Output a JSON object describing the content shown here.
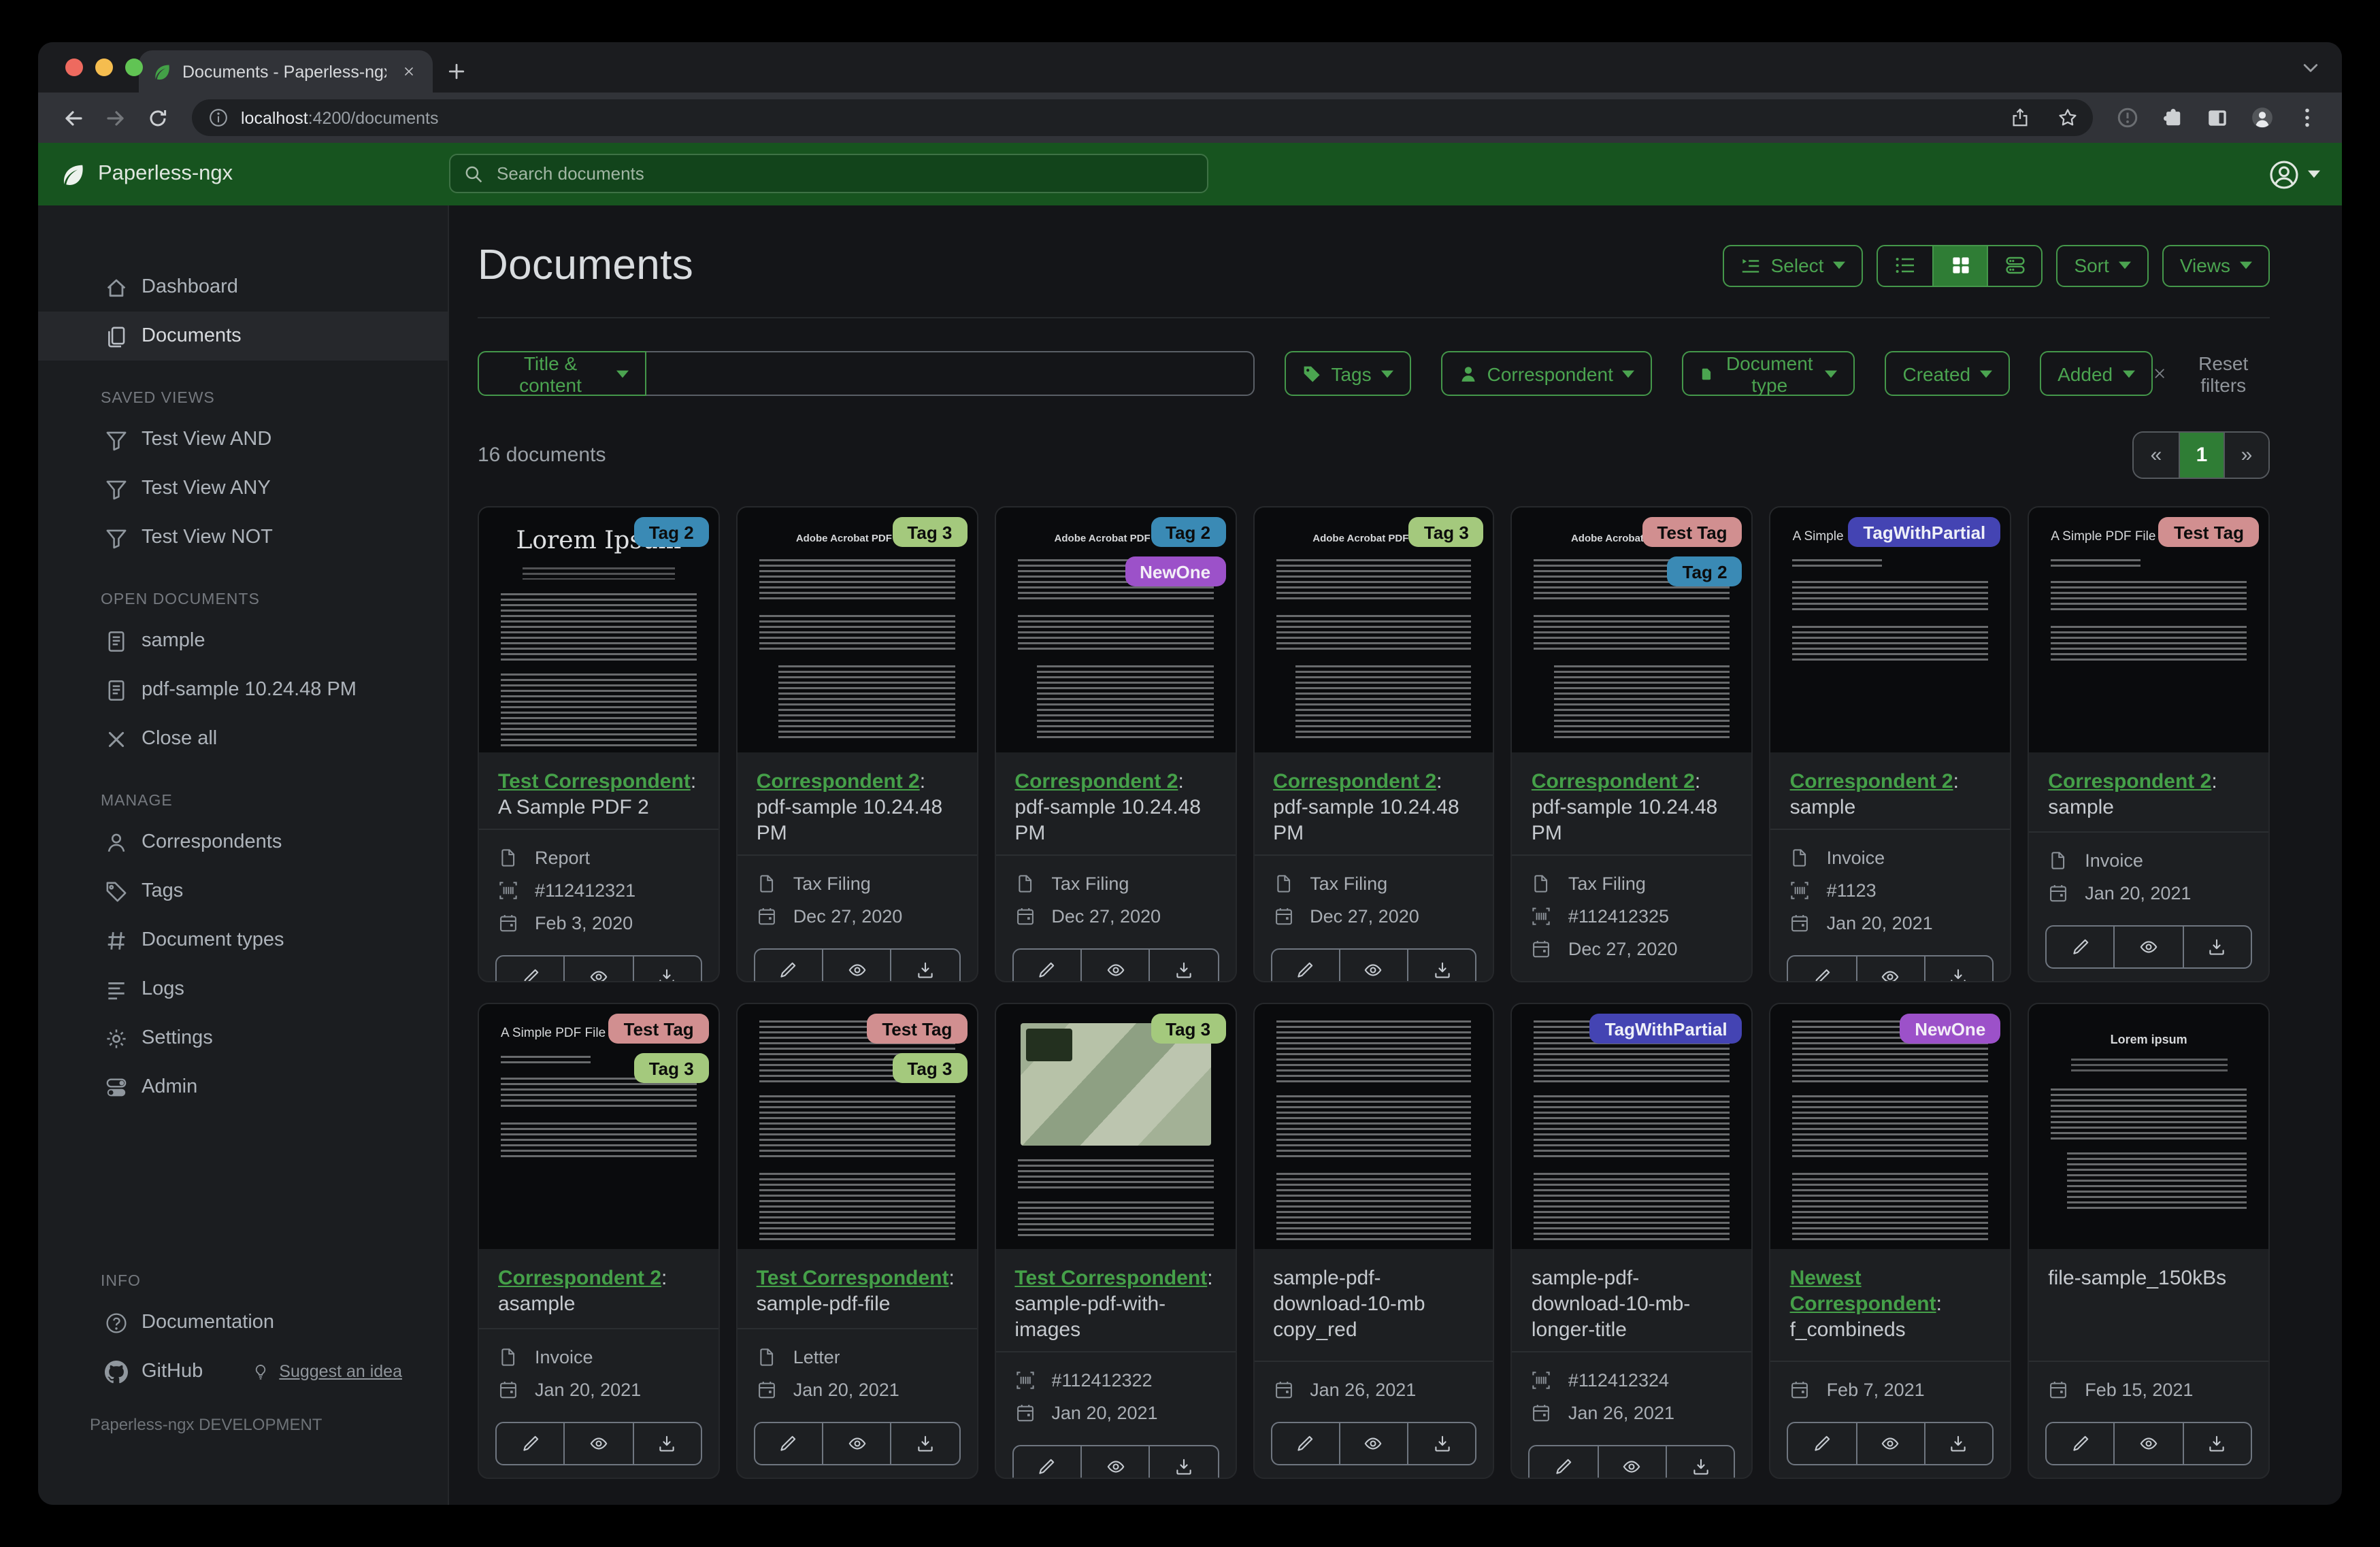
{
  "theme": {
    "navbar_green": "#17541f",
    "accent_green": "#44974a",
    "accent_text": "#4ba450",
    "active_green": "#2f7d35",
    "link_green": "#45a049"
  },
  "browser": {
    "traffic_lights": [
      "#ee6a5f",
      "#f5bd4f",
      "#61c454"
    ],
    "tab": {
      "title": "Documents - Paperless-ngx",
      "favicon": "leaf-icon"
    },
    "url": {
      "host": "localhost",
      "rest": ":4200/documents"
    }
  },
  "navbar": {
    "brand": "Paperless-ngx",
    "search_placeholder": "Search documents"
  },
  "icons": {
    "brand": "leaf-icon",
    "search": "magnifier-icon",
    "user_menu": "person-circle-icon",
    "document_type": "file-icon",
    "asn": "barcode-icon",
    "created": "calendar-icon",
    "edit": "pencil-icon",
    "preview": "eye-icon",
    "download": "download-icon"
  },
  "sidebar": {
    "items_primary": [
      {
        "label": "Dashboard",
        "icon": "home",
        "active": false
      },
      {
        "label": "Documents",
        "icon": "documents",
        "active": true
      }
    ],
    "sections": [
      {
        "title": "SAVED VIEWS",
        "items": [
          {
            "label": "Test View AND",
            "icon": "funnel"
          },
          {
            "label": "Test View ANY",
            "icon": "funnel"
          },
          {
            "label": "Test View NOT",
            "icon": "funnel"
          }
        ]
      },
      {
        "title": "OPEN DOCUMENTS",
        "items": [
          {
            "label": "sample",
            "icon": "file-text"
          },
          {
            "label": "pdf-sample 10.24.48 PM",
            "icon": "file-text"
          },
          {
            "label": "Close all",
            "icon": "close"
          }
        ]
      },
      {
        "title": "MANAGE",
        "items": [
          {
            "label": "Correspondents",
            "icon": "person"
          },
          {
            "label": "Tags",
            "icon": "tag"
          },
          {
            "label": "Document types",
            "icon": "hash"
          },
          {
            "label": "Logs",
            "icon": "lines"
          },
          {
            "label": "Settings",
            "icon": "gear"
          },
          {
            "label": "Admin",
            "icon": "toggles"
          }
        ]
      },
      {
        "title": "INFO",
        "items": [
          {
            "label": "Documentation",
            "icon": "question"
          },
          {
            "label": "GitHub",
            "icon": "github",
            "extra": {
              "label": "Suggest an idea",
              "icon": "bulb"
            }
          }
        ]
      }
    ],
    "footer": "Paperless-ngx DEVELOPMENT"
  },
  "page": {
    "title": "Documents",
    "toolbar": {
      "select_label": "Select",
      "sort_label": "Sort",
      "views_label": "Views"
    },
    "filters": {
      "field_button": "Title & content",
      "query_value": "",
      "dropdowns": [
        {
          "label": "Tags",
          "icon": "tag-fill"
        },
        {
          "label": "Correspondent",
          "icon": "person-fill"
        },
        {
          "label": "Document type",
          "icon": "file-fill"
        },
        {
          "label": "Created",
          "icon": null
        },
        {
          "label": "Added",
          "icon": null
        }
      ],
      "reset_label": "Reset filters"
    },
    "count_label": "16 documents",
    "pagination": {
      "prev": "«",
      "current": "1",
      "next": "»"
    }
  },
  "cards": [
    {
      "thumb": "lorem-serif",
      "thumb_title": "Lorem Ipsum",
      "tags": [
        {
          "label": "Tag 2",
          "bg": "#3a8ab5",
          "fg": "#0c0c0c"
        }
      ],
      "link": "Test Correspondent",
      "suffix": ": A Sample PDF 2",
      "meta": {
        "type": "Report",
        "asn": "#112412321",
        "date": "Feb 3, 2020"
      }
    },
    {
      "thumb": "adobe",
      "thumb_title": "Adobe Acrobat PDF Files",
      "tags": [
        {
          "label": "Tag 3",
          "bg": "#a4c97d",
          "fg": "#0c0c0c"
        }
      ],
      "link": "Correspondent 2",
      "suffix": ": pdf-sample 10.24.48 PM",
      "meta": {
        "type": "Tax Filing",
        "date": "Dec 27, 2020"
      }
    },
    {
      "thumb": "adobe",
      "thumb_title": "Adobe Acrobat PDF Files",
      "tags": [
        {
          "label": "Tag 2",
          "bg": "#3a8ab5",
          "fg": "#0c0c0c"
        },
        {
          "label": "NewOne",
          "bg": "#9c51c9",
          "fg": "#f3eef7"
        }
      ],
      "link": "Correspondent 2",
      "suffix": ": pdf-sample 10.24.48 PM",
      "meta": {
        "type": "Tax Filing",
        "date": "Dec 27, 2020"
      }
    },
    {
      "thumb": "adobe",
      "thumb_title": "Adobe Acrobat PDF Files",
      "tags": [
        {
          "label": "Tag 3",
          "bg": "#a4c97d",
          "fg": "#0c0c0c"
        }
      ],
      "link": "Correspondent 2",
      "suffix": ": pdf-sample 10.24.48 PM",
      "meta": {
        "type": "Tax Filing",
        "date": "Dec 27, 2020"
      }
    },
    {
      "thumb": "adobe",
      "thumb_title": "Adobe Acrobat PDF Files",
      "tags": [
        {
          "label": "Test Tag",
          "bg": "#d18f90",
          "fg": "#0c0c0c"
        },
        {
          "label": "Tag 2",
          "bg": "#3a8ab5",
          "fg": "#0c0c0c"
        }
      ],
      "link": "Correspondent 2",
      "suffix": ": pdf-sample 10.24.48 PM",
      "meta": {
        "type": "Tax Filing",
        "asn": "#112412325",
        "date": "Dec 27, 2020"
      }
    },
    {
      "thumb": "simple",
      "thumb_title": "A Simple PDF File",
      "tags": [
        {
          "label": "TagWithPartial",
          "bg": "#4444b3",
          "fg": "#eef0f8"
        }
      ],
      "link": "Correspondent 2",
      "suffix": ": sample",
      "meta": {
        "type": "Invoice",
        "asn": "#1123",
        "date": "Jan 20, 2021"
      }
    },
    {
      "thumb": "simple",
      "thumb_title": "A Simple PDF File",
      "tags": [
        {
          "label": "Test Tag",
          "bg": "#d18f90",
          "fg": "#0c0c0c"
        }
      ],
      "link": "Correspondent 2",
      "suffix": ": sample",
      "meta": {
        "type": "Invoice",
        "date": "Jan 20, 2021"
      }
    },
    {
      "thumb": "simple",
      "thumb_title": "A Simple PDF File",
      "tags": [
        {
          "label": "Test Tag",
          "bg": "#d18f90",
          "fg": "#0c0c0c"
        },
        {
          "label": "Tag 3",
          "bg": "#a4c97d",
          "fg": "#0c0c0c"
        }
      ],
      "link": "Correspondent 2",
      "suffix": ": asample",
      "meta": {
        "type": "Invoice",
        "date": "Jan 20, 2021"
      }
    },
    {
      "thumb": "dense",
      "thumb_title": "",
      "tags": [
        {
          "label": "Test Tag",
          "bg": "#d18f90",
          "fg": "#0c0c0c"
        },
        {
          "label": "Tag 3",
          "bg": "#a4c97d",
          "fg": "#0c0c0c"
        }
      ],
      "link": "Test Correspondent",
      "suffix": ": sample-pdf-file",
      "meta": {
        "type": "Letter",
        "date": "Jan 20, 2021"
      }
    },
    {
      "thumb": "map",
      "thumb_title": "",
      "tags": [
        {
          "label": "Tag 3",
          "bg": "#a4c97d",
          "fg": "#0c0c0c"
        }
      ],
      "link": "Test Correspondent",
      "suffix": ": sample-pdf-with-images",
      "meta": {
        "asn": "#112412322",
        "date": "Jan 20, 2021"
      }
    },
    {
      "thumb": "dense",
      "thumb_title": "",
      "tags": [],
      "title": "sample-pdf-download-10-mb copy_red",
      "meta": {
        "date": "Jan 26, 2021"
      }
    },
    {
      "thumb": "dense",
      "thumb_title": "",
      "tags": [
        {
          "label": "TagWithPartial",
          "bg": "#4444b3",
          "fg": "#eef0f8"
        }
      ],
      "title": "sample-pdf-download-10-mb-longer-title",
      "meta": {
        "asn": "#112412324",
        "date": "Jan 26, 2021"
      }
    },
    {
      "thumb": "dense",
      "thumb_title": "",
      "tags": [
        {
          "label": "NewOne",
          "bg": "#9c51c9",
          "fg": "#f3eef7"
        }
      ],
      "link": "Newest Correspondent",
      "suffix": ": f_combineds",
      "meta": {
        "date": "Feb 7, 2021"
      }
    },
    {
      "thumb": "lorem-center",
      "thumb_title": "Lorem ipsum",
      "tags": [],
      "title": "file-sample_150kBs",
      "meta": {
        "date": "Feb 15, 2021"
      }
    }
  ]
}
